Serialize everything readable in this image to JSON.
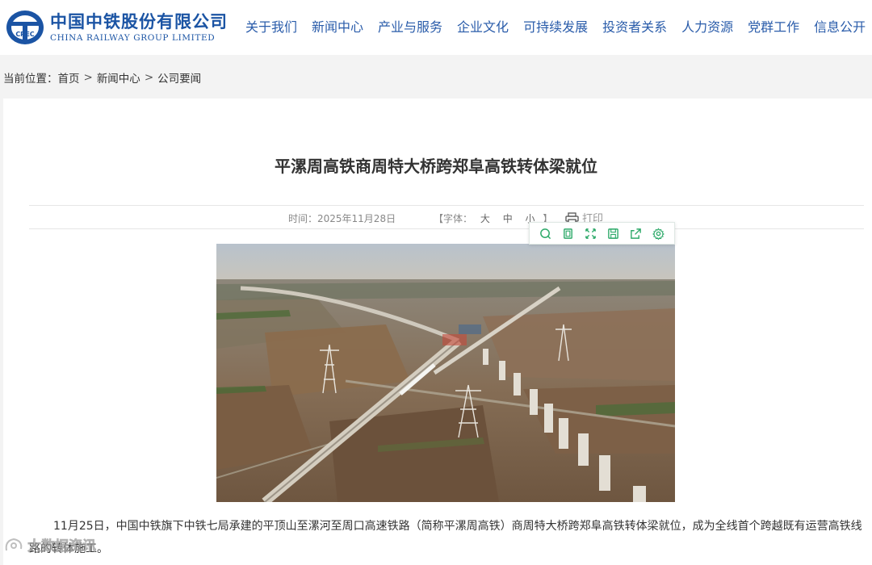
{
  "brand": {
    "name_cn": "中国中铁股份有限公司",
    "name_en": "CHINA RAILWAY GROUP LIMITED",
    "logo_mark_text": "CREC",
    "color": "#1b54a4"
  },
  "nav": {
    "items": [
      "关于我们",
      "新闻中心",
      "产业与服务",
      "企业文化",
      "可持续发展",
      "投资者关系",
      "人力资源",
      "党群工作",
      "信息公开"
    ]
  },
  "breadcrumb": {
    "prefix": "当前位置：",
    "home": "首页",
    "section": "新闻中心",
    "current": "公司要闻",
    "separator": ">"
  },
  "article": {
    "title": "平漯周高铁商周特大桥跨郑阜高铁转体梁就位",
    "time_label": "时间：2025年11月28日",
    "font_open": "【字体：",
    "font_options": [
      "大",
      "中",
      "小"
    ],
    "font_close": "】",
    "print_label": "打印",
    "print_icon": "printer-icon",
    "paragraph": "11月25日，中国中铁旗下中铁七局承建的平顶山至漯河至周口高速铁路（简称平漯周高铁）商周特大桥跨郑阜高铁转体梁就位，成为全线首个跨越既有运营高铁线路的转体施工。"
  },
  "image_toolbar": {
    "icons": [
      "search-icon",
      "copy-icon",
      "fullscreen-icon",
      "save-icon",
      "share-icon",
      "settings-icon"
    ],
    "accent": "#2eaa6a"
  },
  "watermark": {
    "text": "大数据资讯"
  }
}
